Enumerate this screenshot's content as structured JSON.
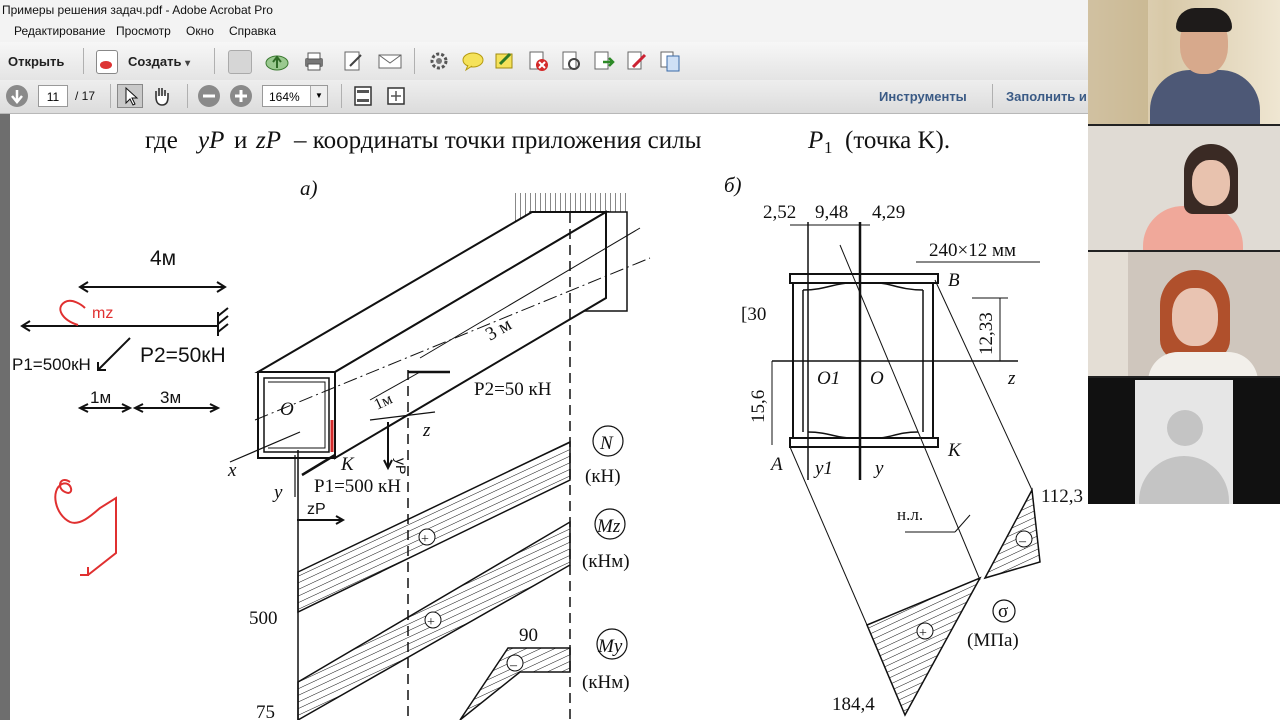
{
  "window": {
    "title": "Примеры решения задач.pdf - Adobe Acrobat Pro"
  },
  "menu": [
    "Редактирование",
    "Просмотр",
    "Окно",
    "Справка"
  ],
  "toolbar": {
    "open_label": "Открыть",
    "create_label": "Создать",
    "create_arrow": "▾"
  },
  "navigation": {
    "current_page": "11",
    "total_pages": "/ 17",
    "zoom": "164%"
  },
  "panels": {
    "tools_label": "Инструменты",
    "fill_label": "Заполнить и"
  },
  "document": {
    "text_where": "где",
    "text_yp": "yP",
    "text_and": "и",
    "text_zp": "zP",
    "text_rest": "– координаты точки приложения силы",
    "text_p": "P",
    "text_psub": "1",
    "text_point": "(точка K).",
    "label_a": "а)",
    "label_b": "б)",
    "beam": {
      "len3": "3 м",
      "len1": "1м",
      "O": "O",
      "z": "z",
      "x": "x",
      "y": "y",
      "K": "K",
      "P2": "P2=50 кН",
      "P1": "P1=500 кН",
      "N": "N",
      "N_unit": "(кН)",
      "Mz": "Mz",
      "Mz_unit": "(кНм)",
      "My": "My",
      "My_unit": "(кНм)",
      "v500": "500",
      "v75": "75",
      "v90": "90",
      "plus": "+",
      "minus": "–"
    },
    "section": {
      "d1": "2,52",
      "d2": "9,48",
      "d3": "4,29",
      "plate": "240×12 мм",
      "channel": "[30",
      "B": "B",
      "h1": "12,33",
      "z": "z",
      "O1": "O1",
      "O": "O",
      "h2": "15,6",
      "A": "A",
      "y1": "y1",
      "y": "y",
      "K": "K",
      "nl": "н.л.",
      "s1": "112,3",
      "s2": "184,4",
      "sigma": "σ",
      "sigma_unit": "(МПа)"
    },
    "handwritten": {
      "len4": "4м",
      "mz": "mz",
      "p1": "P1=500кН",
      "p2": "P2=50кН",
      "one": "1м",
      "three": "3м",
      "zp": "zP",
      "yp": "yP"
    }
  },
  "participants": [
    "participant-1",
    "participant-2",
    "participant-3",
    "participant-4"
  ],
  "colors": {
    "handwriting_red": "#e03030",
    "handwriting_black": "#111111",
    "tools_blue": "#3a5a85"
  }
}
